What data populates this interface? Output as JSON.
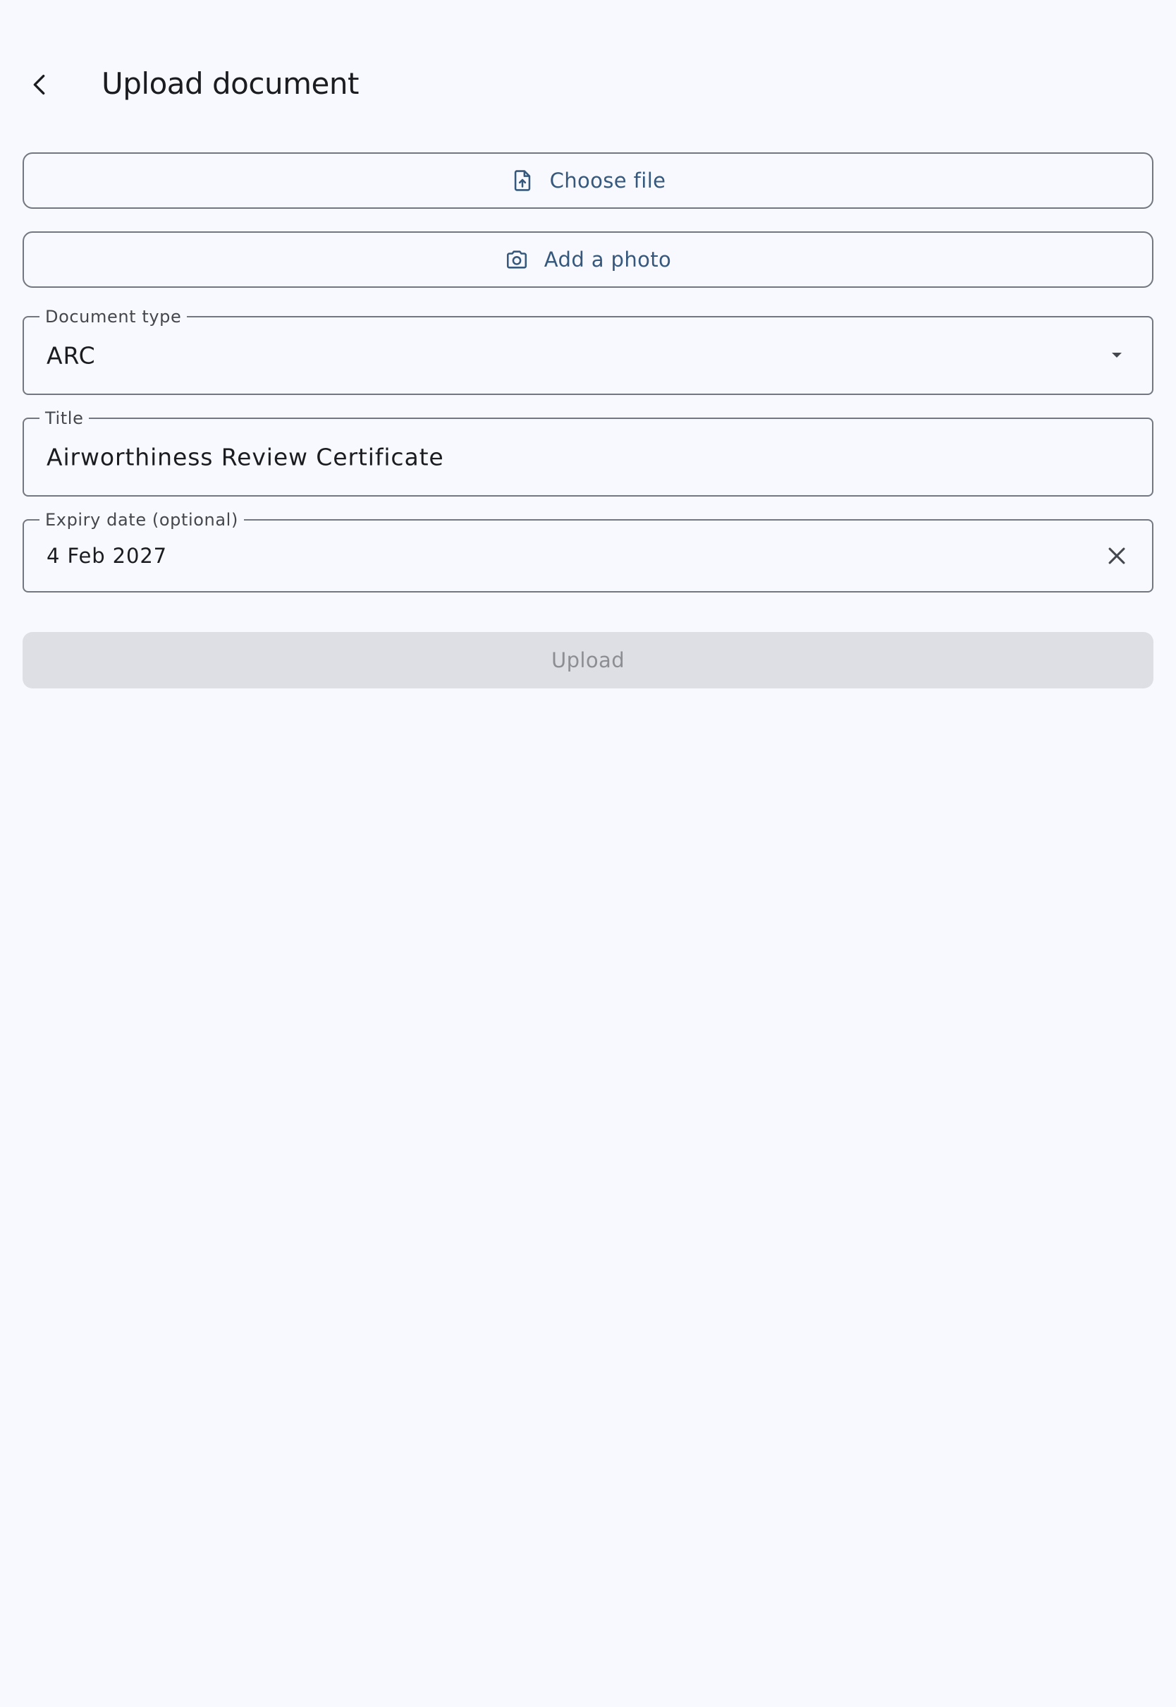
{
  "app_bar": {
    "title": "Upload document",
    "back_icon": "chevron-left-icon"
  },
  "actions": {
    "choose_file_label": "Choose file",
    "choose_file_icon": "file-upload-icon",
    "add_photo_label": "Add a photo",
    "add_photo_icon": "camera-icon"
  },
  "form": {
    "document_type": {
      "label": "Document type",
      "value": "ARC",
      "icon": "dropdown-arrow-icon"
    },
    "title": {
      "label": "Title",
      "value": "Airworthiness Review Certificate"
    },
    "expiry_date": {
      "label": "Expiry date (optional)",
      "value": "4 Feb 2027",
      "icon": "close-icon"
    }
  },
  "submit": {
    "label": "Upload",
    "state": "disabled"
  },
  "colors": {
    "background": "#f8f9fe",
    "primary": "#35587c",
    "outline": "#73777f",
    "disabled_bg": "#dedfe4",
    "disabled_text": "#8c8e93"
  }
}
